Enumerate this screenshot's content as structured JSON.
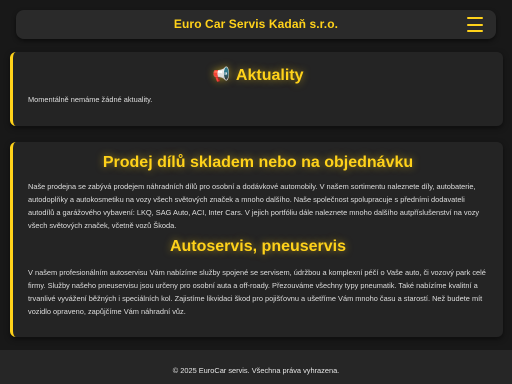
{
  "header": {
    "title": "Euro Car Servis Kadaň s.r.o.",
    "menu_icon": "hamburger-menu-icon",
    "accent_color": "#ffd21a"
  },
  "news": {
    "icon": "megaphone-icon",
    "icon_glyph": "📢",
    "heading": "Aktuality",
    "text": "Momentálně nemáme žádné aktuality."
  },
  "parts": {
    "heading": "Prodej dílů skladem nebo na objednávku",
    "text": "Naše prodejna se zabývá prodejem náhradních dílů pro osobní a dodávkové automobily. V našem sortimentu naleznete díly, autobaterie, autodoplňky a autokosmetiku na vozy všech světových značek a mnoho dalšího. Naše společnost spolupracuje s předními dodavateli autodílů a garážového vybavení: LKQ, SAG Auto, ACI, Inter Cars. V jejich portfóliu dále naleznete mnoho dalšího autpříslušenství na vozy všech světových značek, včetně vozů Škoda."
  },
  "service": {
    "heading": "Autoservis, pneuservis",
    "text": "V našem profesionálním autoservisu Vám nabízíme služby spojené se servisem, údržbou a komplexní péčí o Vaše auto, či vozový park celé firmy. Služby našeho pneuservisu jsou určeny pro osobní auta a off-roady. Přezouváme všechny typy pneumatik. Také nabízíme kvalitní a trvanlivé vyvážení běžných i speciálních kol. Zajistíme likvidaci škod pro pojišťovnu a ušetříme Vám mnoho času a starostí. Než budete mít vozidlo opraveno, zapůjčíme Vám náhradní vůz."
  },
  "footer": {
    "text": "© 2025 EuroCar servis. Všechna práva vyhrazena."
  }
}
